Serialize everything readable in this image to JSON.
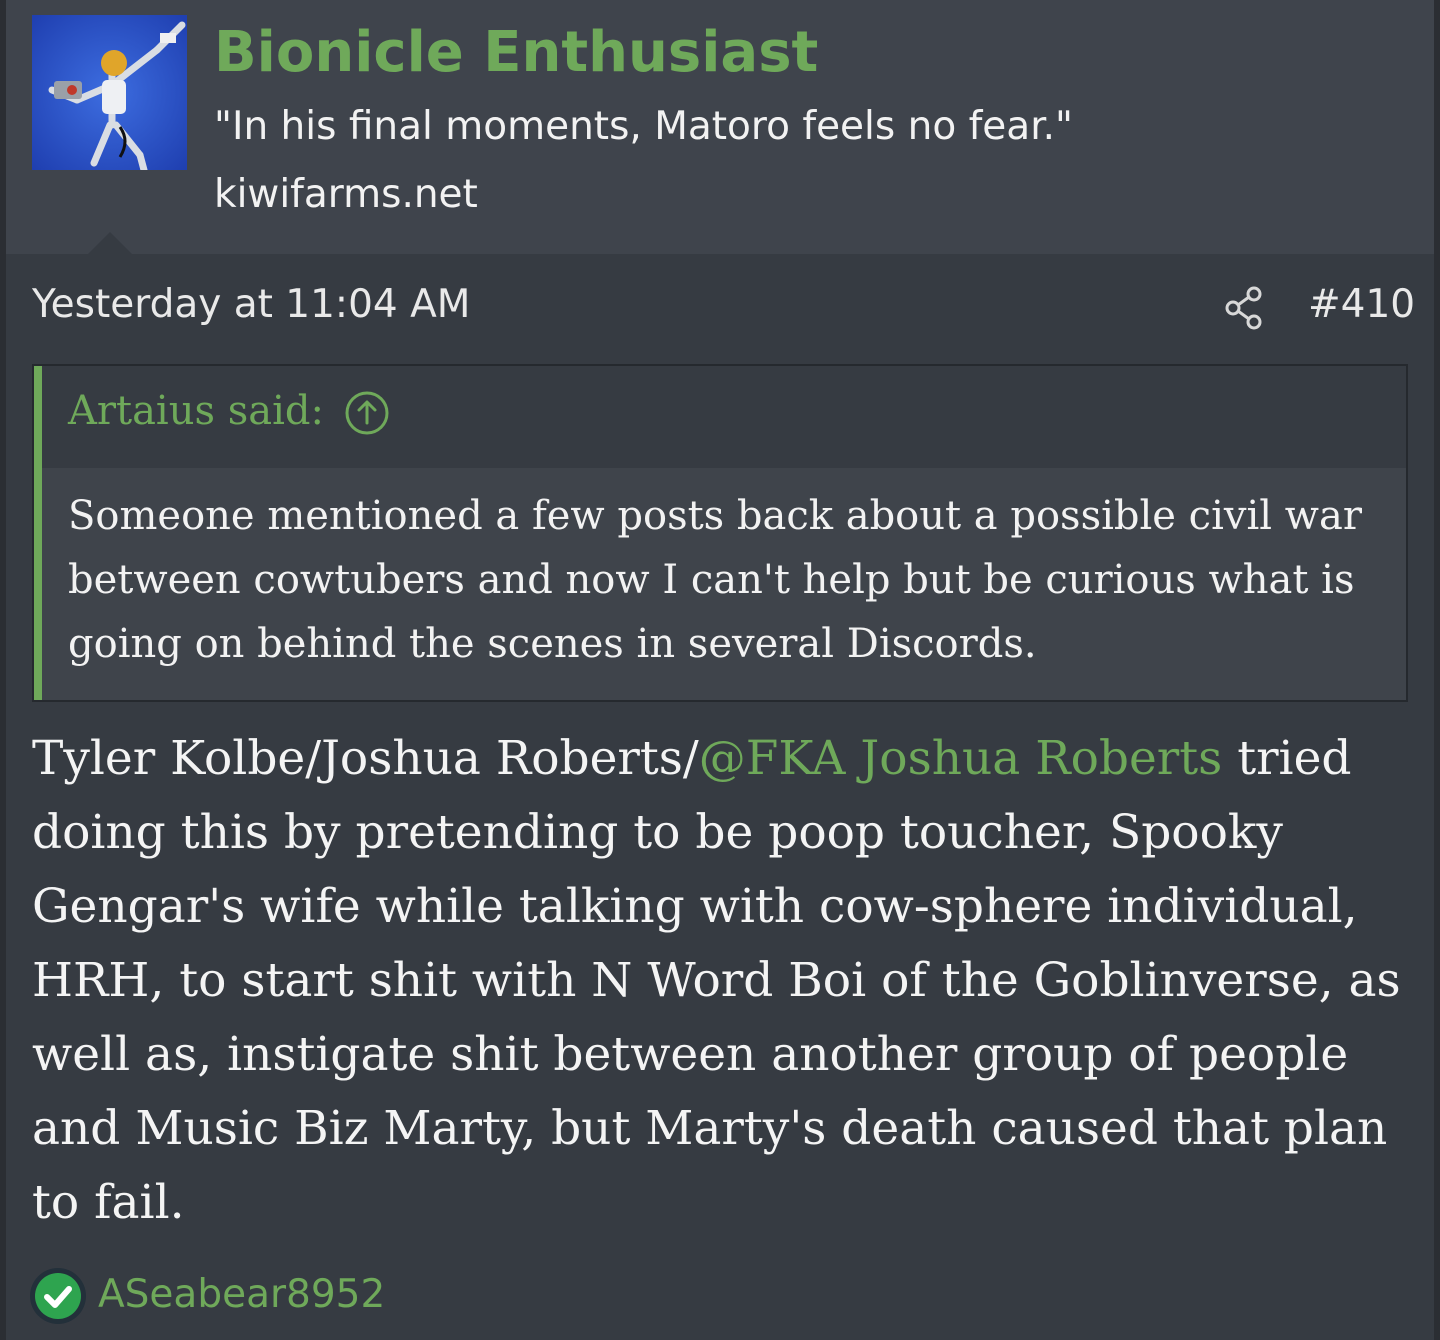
{
  "author": {
    "username": "Bionicle Enthusiast",
    "title": "\"In his final moments, Matoro feels no fear.\"",
    "site": "kiwifarms.net"
  },
  "post": {
    "time": "Yesterday at 11:04 AM",
    "number": "#410"
  },
  "quote": {
    "author_label": "Artaius said:",
    "text": "Someone mentioned a few posts back about a possible civil war between cowtubers and now I can't help but be curious what is going on behind the scenes in several Discords."
  },
  "body": {
    "part1": "Tyler Kolbe/Joshua Roberts/",
    "mention": "@FKA Joshua Roberts",
    "part2": " tried doing this by pretending to be poop toucher, Spooky Gengar's wife while talking with cow-sphere individual, HRH, to start shit with N Word Boi of the Goblinverse, as well as, instigate shit between another group of people and Music Biz Marty, but Marty's death caused that plan to fail."
  },
  "reactions": {
    "icon": "check-circle-icon",
    "user": "ASeabear8952"
  },
  "colors": {
    "accent": "#6fa95a",
    "header_bg": "#3f444c",
    "post_bg": "#363b42",
    "reaction_green": "#2ea44f"
  }
}
